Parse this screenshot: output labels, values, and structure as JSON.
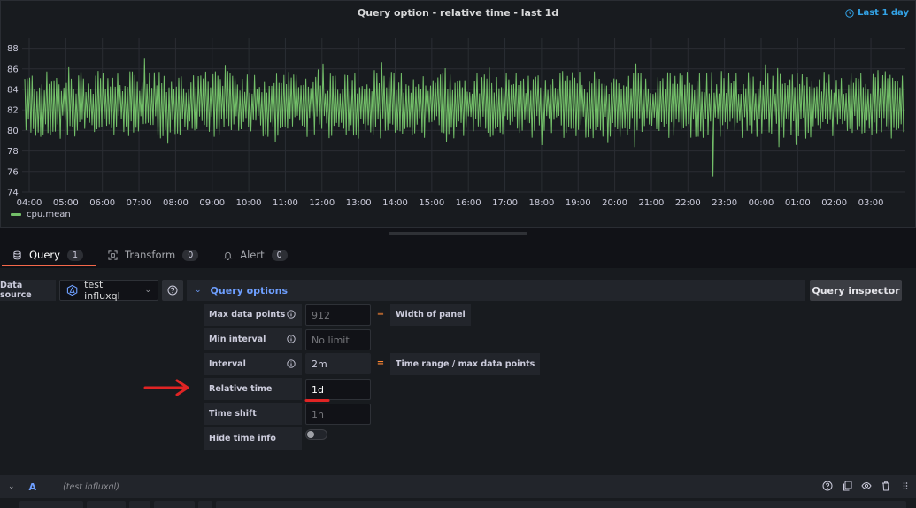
{
  "panel": {
    "title": "Query option - relative time - last 1d",
    "time_badge": "Last 1 day",
    "legend": "cpu.mean"
  },
  "chart_data": {
    "type": "line",
    "title": "Query option - relative time - last 1d",
    "xlabel": "",
    "ylabel": "",
    "ylim": [
      74,
      89
    ],
    "y_ticks": [
      "88",
      "86",
      "84",
      "82",
      "80",
      "78",
      "76",
      "74"
    ],
    "x_ticks": [
      "04:00",
      "05:00",
      "06:00",
      "07:00",
      "08:00",
      "09:00",
      "10:00",
      "11:00",
      "12:00",
      "13:00",
      "14:00",
      "15:00",
      "16:00",
      "17:00",
      "18:00",
      "19:00",
      "20:00",
      "21:00",
      "22:00",
      "23:00",
      "00:00",
      "01:00",
      "02:00",
      "03:00"
    ],
    "grid": true,
    "legend_position": "bottom-left",
    "series": [
      {
        "name": "cpu.mean",
        "color": "#73bf69",
        "x_start": "03:40",
        "x_end": "03:50",
        "points": 720,
        "values_range": [
          75.5,
          87
        ],
        "typical_range": [
          79.5,
          85.5
        ],
        "notable": {
          "min_at": "22:25",
          "min_value": 75.5,
          "max_at": "06:55",
          "max_value": 87
        }
      }
    ]
  },
  "tabs": [
    {
      "label": "Query",
      "count": "1",
      "icon": "database-icon",
      "active": true
    },
    {
      "label": "Transform",
      "count": "0",
      "icon": "transform-icon",
      "active": false
    },
    {
      "label": "Alert",
      "count": "0",
      "icon": "bell-icon",
      "active": false
    }
  ],
  "datasource": {
    "label": "Data source",
    "value": "test influxql"
  },
  "query_options": {
    "title": "Query options",
    "inspector_label": "Query inspector",
    "rows": {
      "max_data_points": {
        "label": "Max data points",
        "placeholder": "912",
        "equals": "=",
        "desc": "Width of panel"
      },
      "min_interval": {
        "label": "Min interval",
        "placeholder": "No limit"
      },
      "interval": {
        "label": "Interval",
        "value": "2m",
        "equals": "=",
        "desc": "Time range / max data points"
      },
      "relative_time": {
        "label": "Relative time",
        "value": "1d"
      },
      "time_shift": {
        "label": "Time shift",
        "placeholder": "1h"
      },
      "hide_time_info": {
        "label": "Hide time info",
        "enabled": false
      }
    }
  },
  "query_row": {
    "ref_id": "A",
    "datasource_hint": "(test influxql)"
  },
  "colors": {
    "accent": "#6e9fff",
    "series": "#73bf69",
    "annotation": "#e02424",
    "tab_active": "#f5684a"
  }
}
